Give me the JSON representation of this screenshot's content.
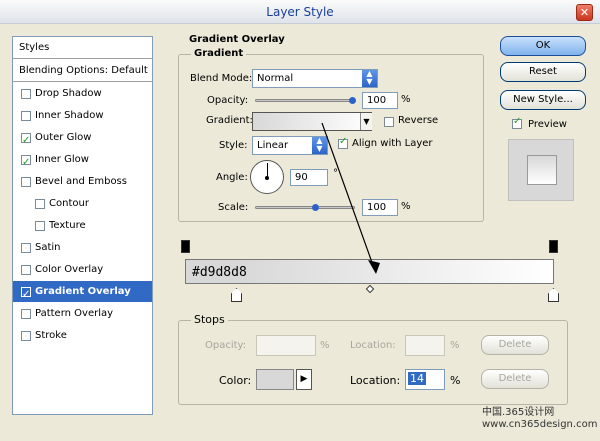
{
  "window": {
    "title": "Layer Style",
    "close_glyph": "✕"
  },
  "styles_list": {
    "header": "Styles",
    "blending": "Blending Options: Default",
    "items": [
      {
        "label": "Drop Shadow",
        "checked": false,
        "indent": false
      },
      {
        "label": "Inner Shadow",
        "checked": false,
        "indent": false
      },
      {
        "label": "Outer Glow",
        "checked": true,
        "indent": false
      },
      {
        "label": "Inner Glow",
        "checked": true,
        "indent": false
      },
      {
        "label": "Bevel and Emboss",
        "checked": false,
        "indent": false
      },
      {
        "label": "Contour",
        "checked": false,
        "indent": true
      },
      {
        "label": "Texture",
        "checked": false,
        "indent": true
      },
      {
        "label": "Satin",
        "checked": false,
        "indent": false
      },
      {
        "label": "Color Overlay",
        "checked": false,
        "indent": false
      },
      {
        "label": "Gradient Overlay",
        "checked": true,
        "indent": false,
        "selected": true
      },
      {
        "label": "Pattern Overlay",
        "checked": false,
        "indent": false
      },
      {
        "label": "Stroke",
        "checked": false,
        "indent": false
      }
    ]
  },
  "gradient_overlay": {
    "title": "Gradient Overlay",
    "group": "Gradient",
    "blend_mode_label": "Blend Mode:",
    "blend_mode": "Normal",
    "opacity_label": "Opacity:",
    "opacity": "100",
    "opacity_unit": "%",
    "gradient_label": "Gradient:",
    "reverse_label": "Reverse",
    "style_label": "Style:",
    "style": "Linear",
    "align_label": "Align with Layer",
    "angle_label": "Angle:",
    "angle": "90",
    "angle_unit": "°",
    "scale_label": "Scale:",
    "scale": "100",
    "scale_unit": "%"
  },
  "gradient_editor": {
    "color_text": "#d9d8d8",
    "stops_title": "Stops",
    "opacity_label": "Opacity:",
    "opacity_unit": "%",
    "location_label_disabled": "Location:",
    "location_unit_disabled": "%",
    "delete_label": "Delete",
    "color_label": "Color:",
    "location_label": "Location:",
    "location_value": "14",
    "location_unit": "%"
  },
  "buttons": {
    "ok": "OK",
    "reset": "Reset",
    "new_style": "New Style...",
    "preview": "Preview"
  },
  "watermark": "中国.365设计网 www.cn365design.com",
  "colors": {
    "gradient_start": "#d9d8d8",
    "gradient_end": "#ffffff",
    "selection": "#316ac5"
  },
  "icons": {
    "arrow": "arrow-annotation-icon"
  }
}
